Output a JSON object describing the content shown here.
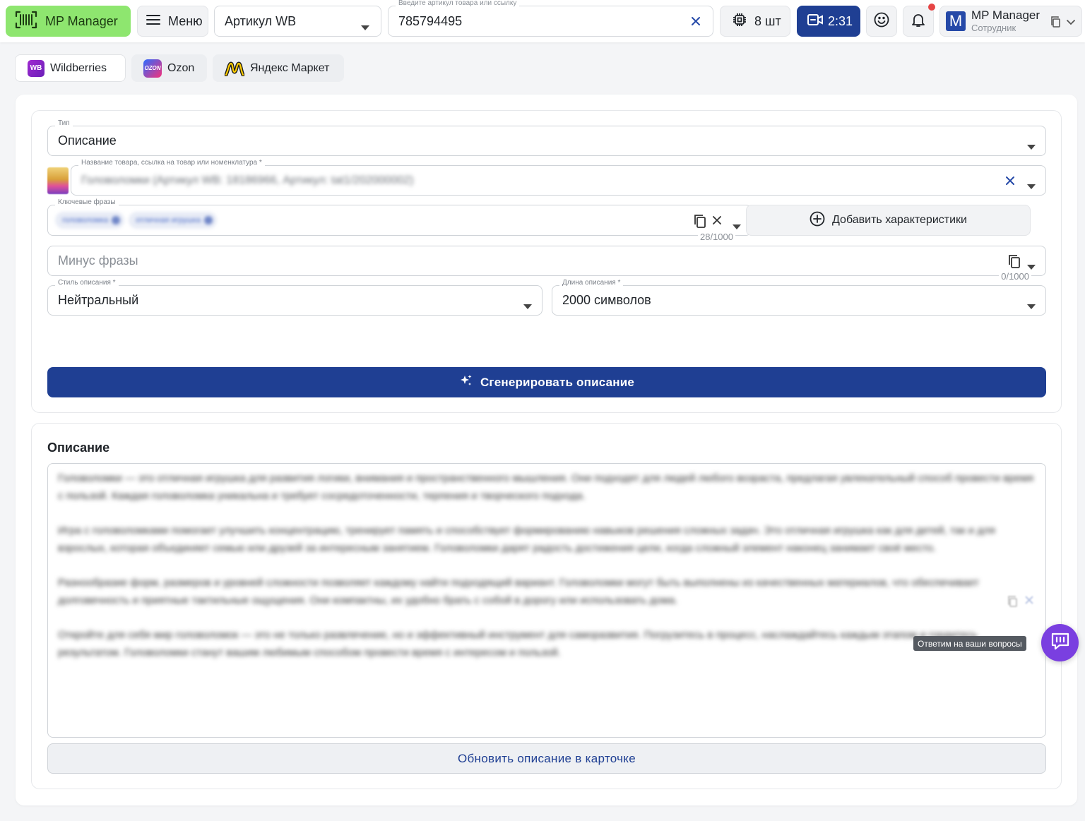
{
  "topbar": {
    "logo_label": "MP Manager",
    "menu_label": "Меню",
    "article_select": {
      "value": "Артикул WB"
    },
    "search": {
      "legend": "Введите артикул товара или ссылку",
      "value": "785794495"
    },
    "count_label": "8 шт",
    "timer_label": "2:31",
    "profile": {
      "initial": "M",
      "name": "MP Manager",
      "role": "Сотрудник"
    },
    "accent_color": "#8ee66f",
    "primary_color": "#1f3f93"
  },
  "marketplaces": [
    {
      "label": "Wildberries",
      "icon_text": "WB",
      "active": true
    },
    {
      "label": "Ozon",
      "icon_text": "OZON",
      "active": false
    },
    {
      "label": "Яндекс Маркет",
      "active": false
    }
  ],
  "form": {
    "type": {
      "legend": "Тип",
      "value": "Описание"
    },
    "product": {
      "legend": "Название товара, ссылка на товар или номенклатура *",
      "value": "Головоломки (Артикул WB: 18186966, Артикул: tat1/202000002)"
    },
    "keywords": {
      "legend": "Ключевые фразы",
      "chips": [
        "головоломка",
        "отличная игрушка"
      ],
      "counter": "28/1000"
    },
    "add_characteristics_label": "Добавить характеристики",
    "minus": {
      "placeholder": "Минус фразы",
      "counter": "0/1000"
    },
    "style": {
      "legend": "Стиль описания *",
      "value": "Нейтральный"
    },
    "length": {
      "legend": "Длина описания *",
      "value": "2000 символов"
    },
    "generate_label": "Сгенерировать описание"
  },
  "result": {
    "title": "Описание",
    "paragraphs": [
      "Головоломки — это отличная игрушка для развития логики, внимания и пространственного мышления. Они подходят для людей любого возраста, предлагая увлекательный способ провести время с пользой. Каждая головоломка уникальна и требует сосредоточенности, терпения и творческого подхода.",
      "Игра с головоломками помогает улучшить концентрацию, тренирует память и способствует формированию навыков решения сложных задач. Это отличная игрушка как для детей, так и для взрослых, которая объединяет семью или друзей за интересным занятием. Головоломки дарят радость достижения цели, когда сложный элемент наконец занимает своё место.",
      "Разнообразие форм, размеров и уровней сложности позволяет каждому найти подходящий вариант. Головоломки могут быть выполнены из качественных материалов, что обеспечивает долговечность и приятные тактильные ощущения. Они компактны, их удобно брать с собой в дорогу или использовать дома.",
      "Откройте для себя мир головоломок — это не только развлечение, но и эффективный инструмент для саморазвития. Погрузитесь в процесс, наслаждайтесь каждым этапом и гордитесь результатом. Головоломки станут вашим любимым способом провести время с интересом и пользой."
    ],
    "update_label": "Обновить описание в карточке"
  },
  "help": {
    "tooltip": "Ответим на ваши вопросы"
  }
}
